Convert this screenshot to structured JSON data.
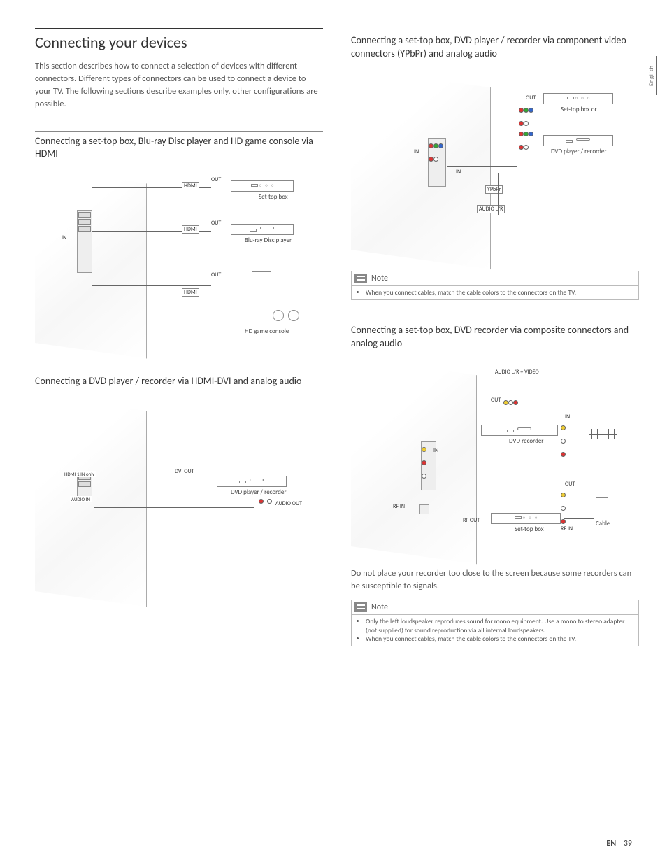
{
  "side_tab": "English",
  "footer": {
    "lang": "EN",
    "page": "39"
  },
  "left": {
    "h2": "Connecting your devices",
    "intro": "This section describes how to connect a selection of devices with different connectors. Different types of connectors can be used to connect a device to your TV. The following sections describe examples only, other configurations are possible.",
    "sec1": {
      "h3": "Connecting a set-top box, Blu-ray Disc player and HD game console via HDMI",
      "labels": {
        "hdmi": "HDMI",
        "in": "IN",
        "out": "OUT",
        "settop": "Set-top box",
        "bluray": "Blu-ray Disc player",
        "console": "HD game console"
      }
    },
    "sec2": {
      "h3": "Connecting a DVD player / recorder via HDMI-DVI and analog audio",
      "labels": {
        "hdmi1": "HDMI 1 IN only",
        "audioin": "AUDIO IN",
        "dviout": "DVI OUT",
        "audioout": "AUDIO OUT",
        "dvd": "DVD player / recorder"
      }
    }
  },
  "right": {
    "sec3": {
      "h3": "Connecting a set-top box, DVD player / recorder via component video connectors (YPbPr) and analog audio",
      "labels": {
        "out": "OUT",
        "in": "IN",
        "ypbpr": "YPbPr",
        "audiolr": "AUDIO L/R",
        "settop_or": "Set-top box or",
        "dvd": "DVD player / recorder"
      },
      "note_title": "Note",
      "note_items": [
        "When you connect cables, match the cable colors to the connectors on the TV."
      ]
    },
    "sec4": {
      "h3": "Connecting a set-top box, DVD recorder via composite connectors and analog audio",
      "labels": {
        "audio_video": "AUDIO L/R + VIDEO",
        "out": "OUT",
        "in": "IN",
        "dvd": "DVD recorder",
        "rfin": "RF IN",
        "rfout": "RF OUT",
        "settop": "Set-top box",
        "cable": "Cable"
      },
      "body": "Do not place your recorder too close to the screen because some recorders can be susceptible to signals.",
      "note_title": "Note",
      "note_items": [
        "Only the left loudspeaker reproduces sound for mono equipment. Use a mono to stereo adapter (not supplied) for sound reproduction via all internal loudspeakers.",
        "When you connect cables, match the cable colors to the connectors on the TV."
      ]
    }
  }
}
